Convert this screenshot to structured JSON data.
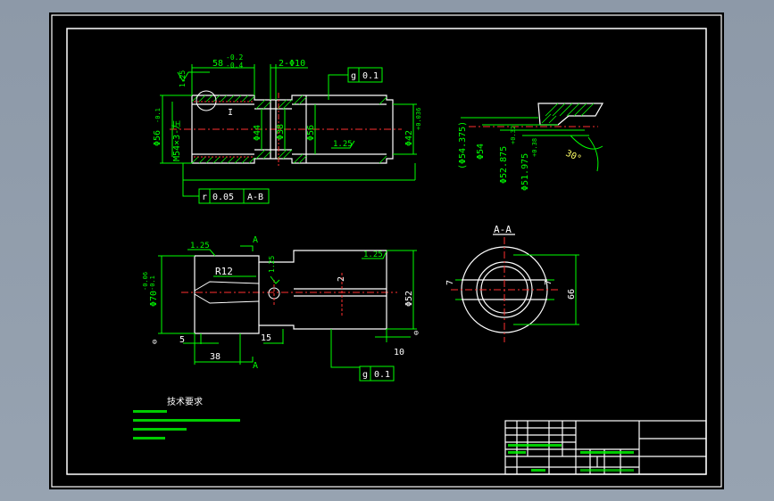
{
  "drawing": {
    "view1": {
      "dims": {
        "d58": "58",
        "d58_tol_up": "-0.2",
        "d58_tol_lo": "-0.4",
        "d2phi10": "2-Φ10",
        "rough_tl": "1.25",
        "d56_left": "Φ56",
        "d56_left_tol": "-0.1",
        "thread": "M54×3-左",
        "d44": "Φ44",
        "d38": "Φ38",
        "d56_mid": "Φ56",
        "rough_mid": "1.25",
        "d42": "Φ42",
        "d42_tol": "+0.036",
        "detail_mark": "I",
        "flatness_sym": "g",
        "flatness_val": "0.1",
        "runout_sym": "r",
        "runout_val": "0.05",
        "runout_ref": "A-B"
      }
    },
    "detail": {
      "dims": {
        "d54375": "(Φ54.375)",
        "d54": "Φ54",
        "d52875": "Φ52.875",
        "d52875_tol": "+0.32",
        "d51975": "Φ51.975",
        "d51975_tol": "+0.38",
        "angle": "30°"
      }
    },
    "view2": {
      "dims": {
        "rough_a": "1.25",
        "rough_b": "1.25",
        "rough_c": "1.25",
        "r12": "R12",
        "section_mark": "A",
        "d70": "Φ70",
        "d70_tol_up": "-0.06",
        "d70_tol_lo": "-0.1",
        "d52": "Φ52",
        "w2": "2",
        "d5": "5",
        "d15": "15",
        "d38": "38",
        "d10": "10",
        "flatness_sym": "g",
        "flatness_val": "0.1"
      }
    },
    "section": {
      "title": "A-A",
      "dims": {
        "d7a": "7",
        "d7b": "7",
        "d66": "66"
      }
    },
    "notes": {
      "heading": "技术要求"
    }
  }
}
